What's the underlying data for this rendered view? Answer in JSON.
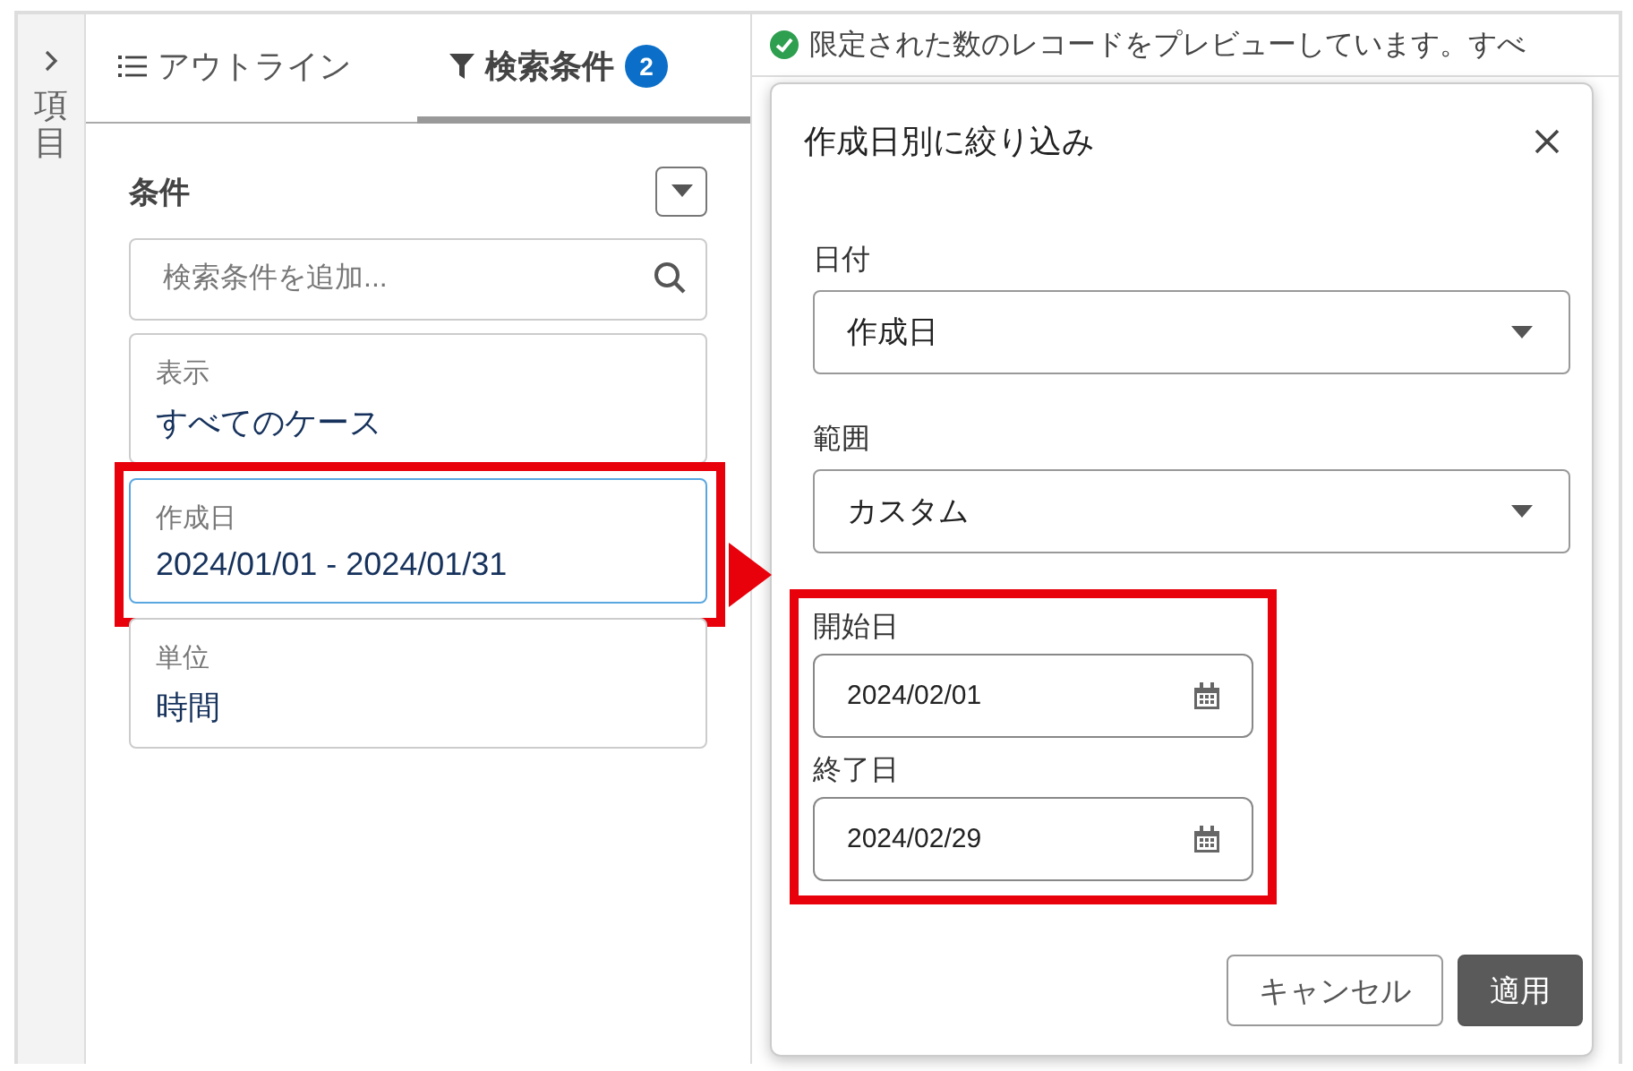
{
  "sidebar_toggle": {
    "label": "項目"
  },
  "tabs": [
    {
      "label": "アウトライン",
      "kind": "outline",
      "selected": false
    },
    {
      "label": "検索条件",
      "kind": "filter",
      "selected": true,
      "badge": "2"
    }
  ],
  "conditions": {
    "title": "条件",
    "search": {
      "placeholder": "検索条件を追加..."
    },
    "items": [
      {
        "label": "表示",
        "value": "すべてのケース",
        "selected": false,
        "highlighted": false
      },
      {
        "label": "作成日",
        "value": "2024/01/01 - 2024/01/31",
        "selected": true,
        "highlighted": true
      },
      {
        "label": "単位",
        "value": "時間",
        "selected": false,
        "highlighted": false
      }
    ]
  },
  "banner": {
    "text": "限定された数のレコードをプレビューしています。すべ"
  },
  "popup": {
    "title": "作成日別に絞り込み",
    "fields": [
      {
        "kind": "select",
        "label": "日付",
        "value": "作成日",
        "highlighted": false
      },
      {
        "kind": "select",
        "label": "範囲",
        "value": "カスタム",
        "highlighted": false
      },
      {
        "kind": "date",
        "label": "開始日",
        "value": "2024/02/01",
        "highlighted": true
      },
      {
        "kind": "date",
        "label": "終了日",
        "value": "2024/02/29",
        "highlighted": true
      }
    ],
    "buttons": [
      {
        "label": "キャンセル",
        "kind": "secondary"
      },
      {
        "label": "適用",
        "kind": "primary"
      }
    ]
  }
}
